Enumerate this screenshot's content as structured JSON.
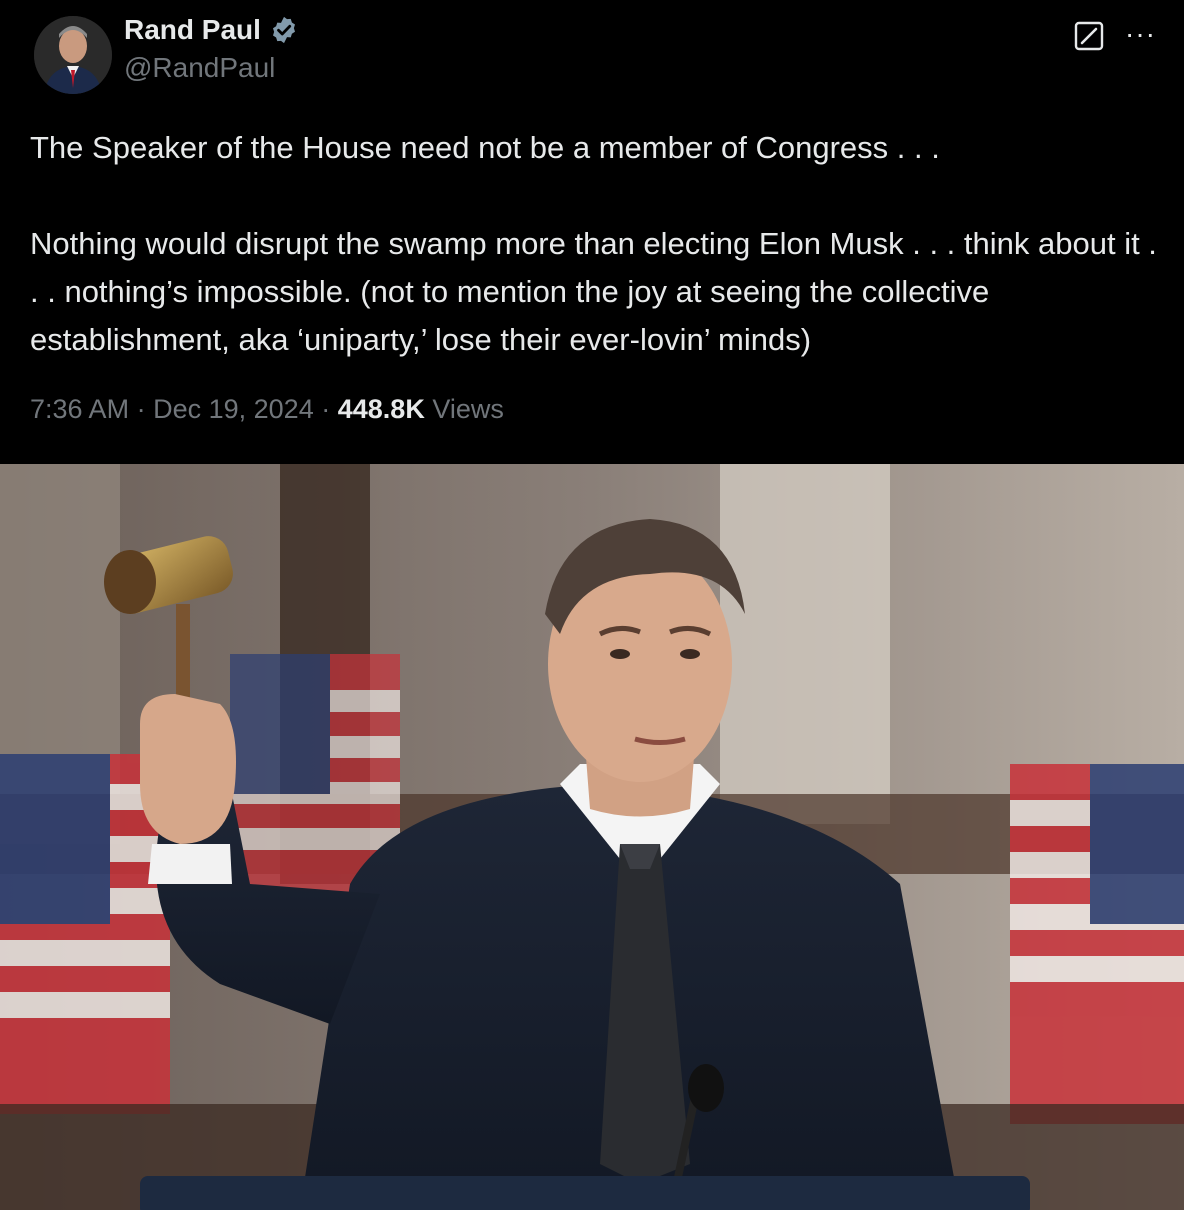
{
  "author": {
    "name": "Rand Paul",
    "handle": "@RandPaul"
  },
  "icons": {
    "verified": "verified-badge-icon",
    "grok": "grok-icon",
    "more": "more-options-icon"
  },
  "post": {
    "line1": "The Speaker of the House need not be a member of Congress . . .",
    "line2": "Nothing would disrupt the swamp more than electing Elon Musk . . . think about it .  . . nothing’s impossible. (not to mention the joy at seeing the collective establishment, aka ‘uniparty,’ lose their ever-lovin’ minds)"
  },
  "meta": {
    "time": "7:36 AM",
    "date": "Dec 19, 2024",
    "views_count": "448.8K",
    "views_label": "Views",
    "separator": "·"
  },
  "colors": {
    "background": "#000000",
    "text": "#e7e9ea",
    "muted": "#71767b",
    "verified": "#829aab"
  }
}
